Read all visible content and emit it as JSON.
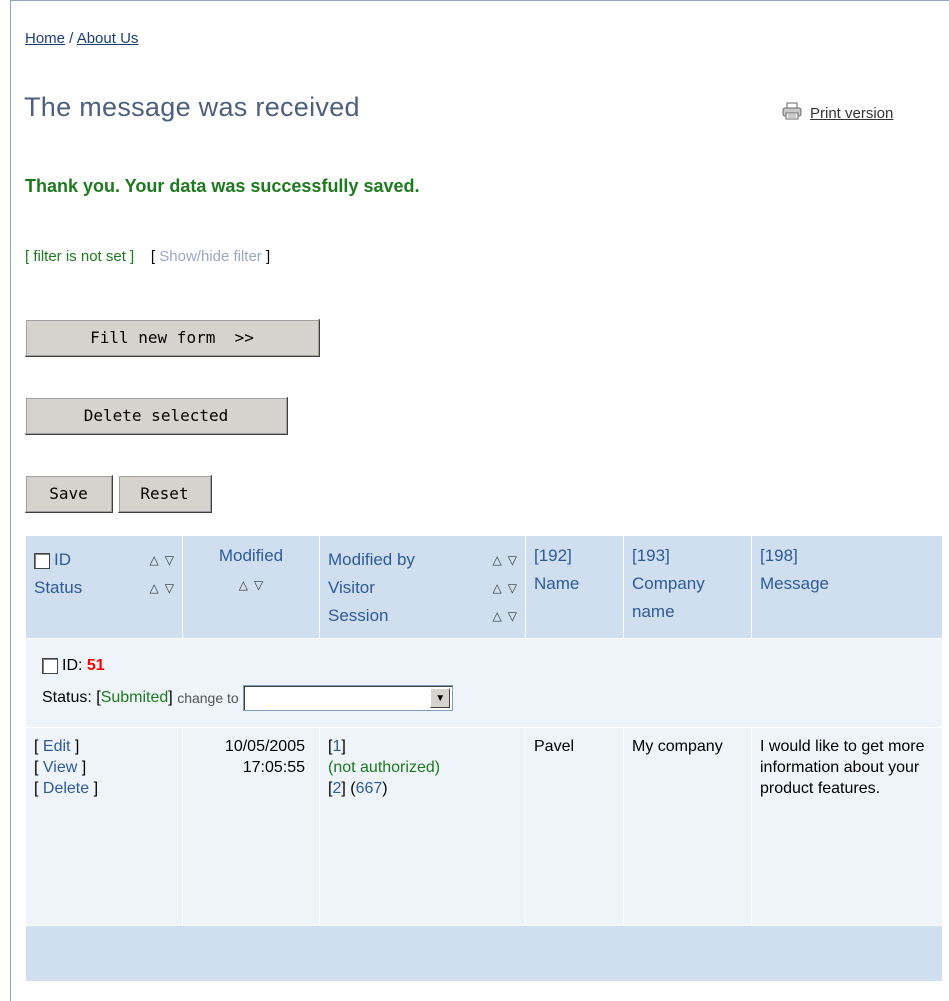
{
  "breadcrumb": {
    "home": "Home",
    "separator": " / ",
    "about": "About Us"
  },
  "page_title": "The message was received",
  "print_version": {
    "label": "Print version",
    "icon": "printer-icon"
  },
  "success_message": "Thank you. Your data was successfully saved.",
  "filter": {
    "status_open": "[ ",
    "status_text": "filter is not set",
    "status_close": " ]",
    "toggle_open": "[ ",
    "toggle_text": "Show/hide filter",
    "toggle_close": " ]"
  },
  "buttons": {
    "fill_new_form": "Fill new form  >>",
    "delete_selected": "Delete selected",
    "save": "Save",
    "reset": "Reset"
  },
  "table": {
    "headers": {
      "id": "ID",
      "status": "Status",
      "modified": "Modified",
      "modified_by": "Modified by",
      "visitor": "Visitor",
      "session": "Session",
      "name_id": "[192]",
      "name": "Name",
      "company_id": "[193]",
      "company_l1": "Company",
      "company_l2": "name",
      "message_id": "[198]",
      "message": "Message",
      "sort_up": "△",
      "sort_down": "▽"
    },
    "record": {
      "id_label": "ID:",
      "id_value": "51",
      "status_label": "Status: [ ",
      "status_value": "Submited",
      "status_close": " ]",
      "change_to": "change to",
      "select_value": ""
    },
    "row": {
      "actions": [
        "Edit",
        "View",
        "Delete"
      ],
      "modified_date": "10/05/2005",
      "modified_time": "17:05:55",
      "modified_by_id": "1",
      "modified_by_status": "(not authorized)",
      "visitor_id": "2",
      "session_id": "667",
      "name": "Pavel",
      "company": "My company",
      "message": "I would like to get more information about your product features."
    }
  }
}
